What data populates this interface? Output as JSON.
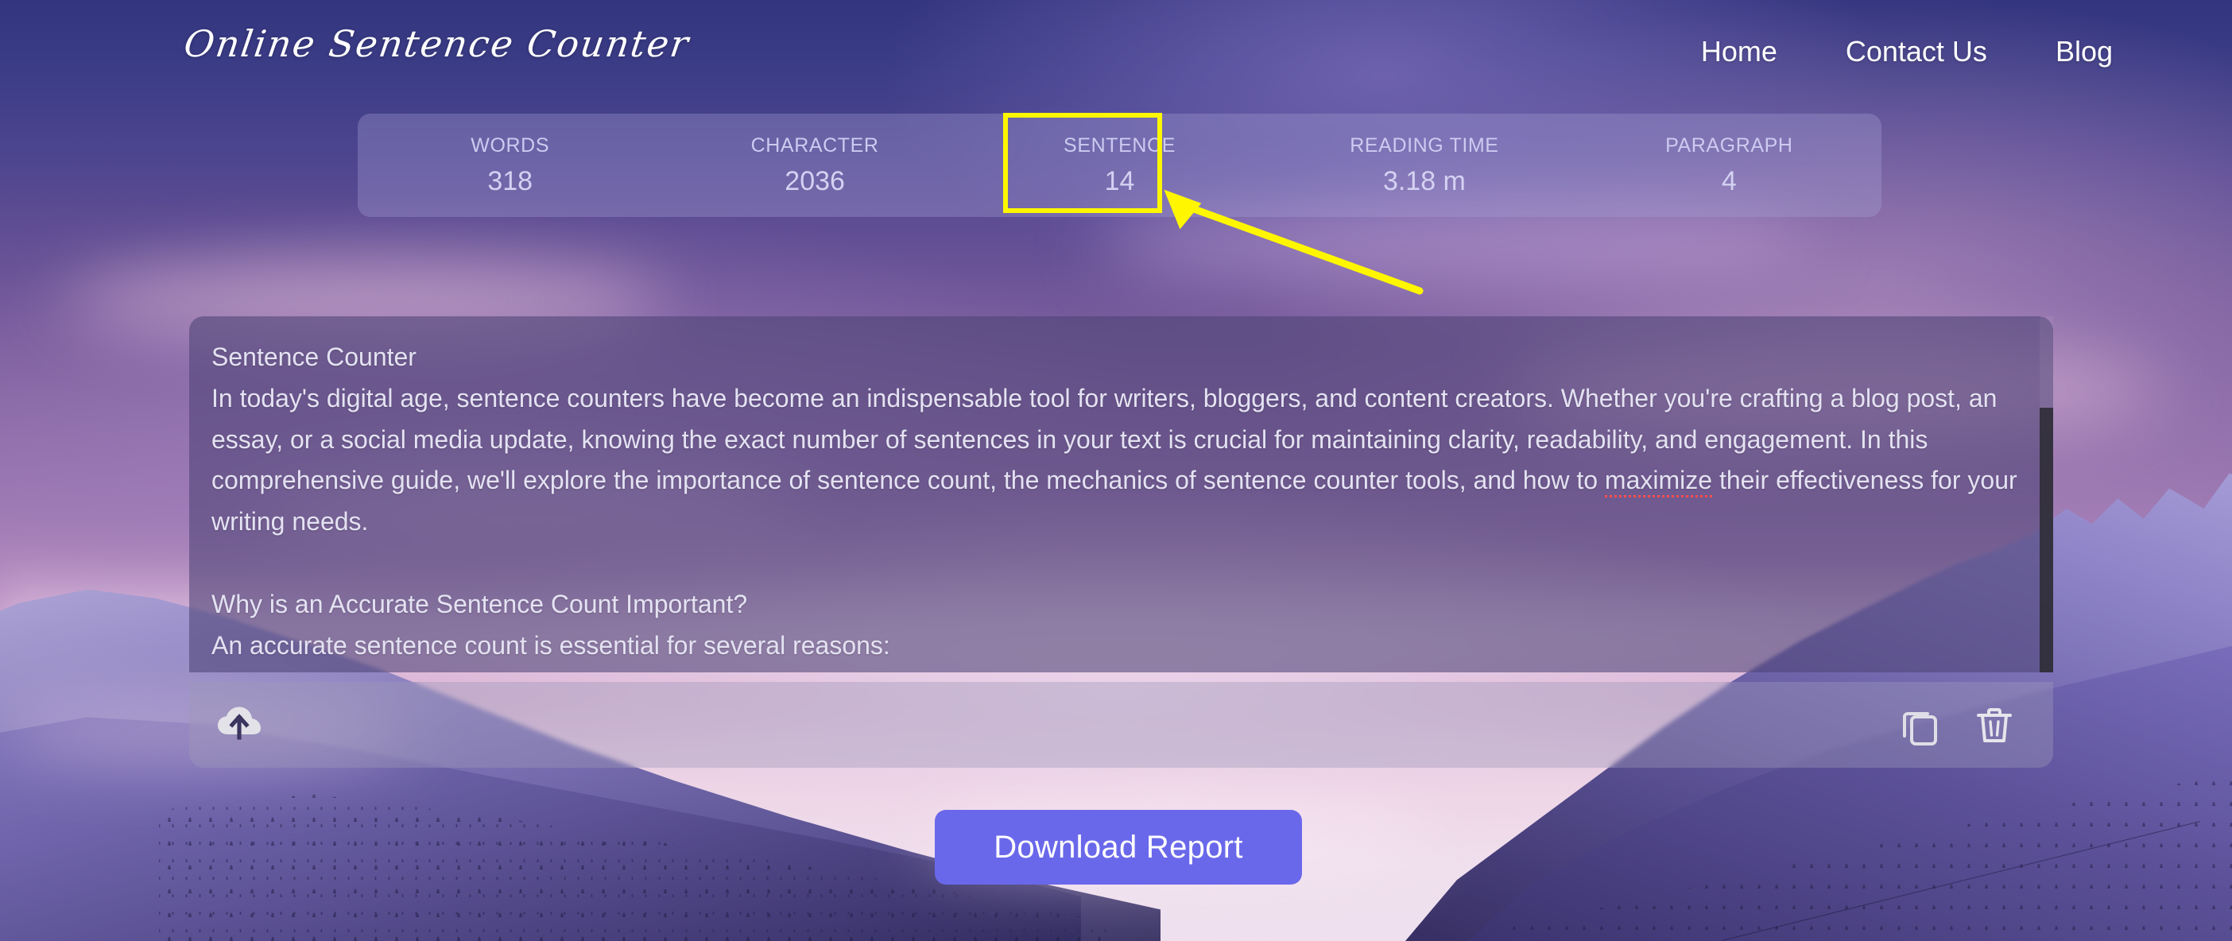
{
  "header": {
    "logo": "Online Sentence Counter",
    "nav": [
      {
        "label": "Home"
      },
      {
        "label": "Contact Us"
      },
      {
        "label": "Blog"
      }
    ]
  },
  "stats": [
    {
      "label": "WORDS",
      "value": "318"
    },
    {
      "label": "CHARACTER",
      "value": "2036"
    },
    {
      "label": "SENTENCE",
      "value": "14"
    },
    {
      "label": "READING TIME",
      "value": "3.18 m"
    },
    {
      "label": "PARAGRAPH",
      "value": "4"
    }
  ],
  "annotation": {
    "highlight_color": "#FFF600",
    "target": "SENTENCE",
    "target_value": "14"
  },
  "editor": {
    "title_line": "Sentence Counter",
    "paragraph_1_a": "In today's digital age, sentence counters have become an indispensable tool for writers, bloggers, and content creators. Whether you're crafting a blog post, an essay, or a social media update, knowing the exact number of sentences in your text is crucial for maintaining clarity, readability, and engagement. In this comprehensive guide, we'll explore the importance of sentence count, the mechanics of sentence counter tools, and how to ",
    "misspelled_word": "maximize",
    "paragraph_1_b": " their effectiveness for your writing needs.",
    "heading_2": "Why is an Accurate Sentence Count Important?",
    "paragraph_2": "An accurate sentence count is essential for several reasons:"
  },
  "toolbar": {
    "upload_icon": "cloud-upload-icon",
    "copy_icon": "copy-icon",
    "delete_icon": "trash-icon"
  },
  "actions": {
    "download_label": "Download Report",
    "download_color": "#6A68EA"
  }
}
